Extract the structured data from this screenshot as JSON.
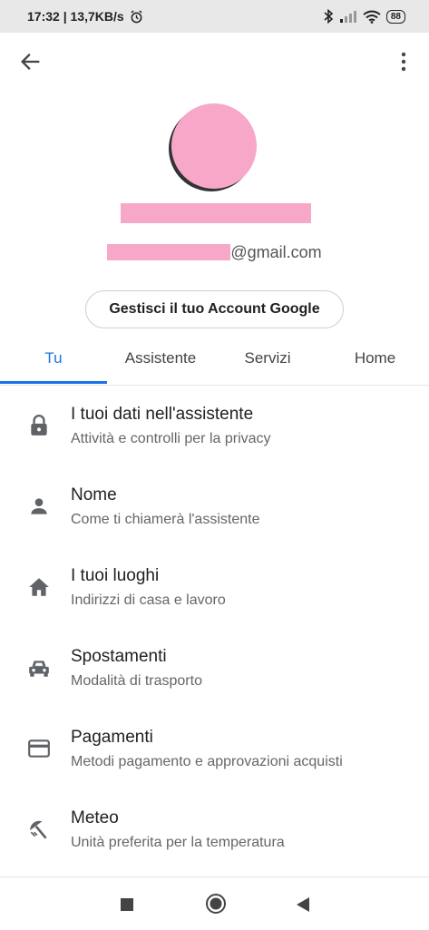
{
  "status_bar": {
    "time_speed": "17:32 | 13,7KB/s",
    "battery": "88"
  },
  "account": {
    "email_suffix": "@gmail.com",
    "manage_label": "Gestisci il tuo Account Google"
  },
  "tabs": [
    {
      "label": "Tu"
    },
    {
      "label": "Assistente"
    },
    {
      "label": "Servizi"
    },
    {
      "label": "Home"
    }
  ],
  "items": [
    {
      "title": "I tuoi dati nell'assistente",
      "subtitle": "Attività e controlli per la privacy",
      "icon": "lock-icon"
    },
    {
      "title": "Nome",
      "subtitle": "Come ti chiamerà l'assistente",
      "icon": "person-icon"
    },
    {
      "title": "I tuoi luoghi",
      "subtitle": "Indirizzi di casa e lavoro",
      "icon": "home-icon"
    },
    {
      "title": "Spostamenti",
      "subtitle": "Modalità di trasporto",
      "icon": "car-icon"
    },
    {
      "title": "Pagamenti",
      "subtitle": "Metodi pagamento e approvazioni acquisti",
      "icon": "credit-card-icon"
    },
    {
      "title": "Meteo",
      "subtitle": "Unità preferita per la temperatura",
      "icon": "weather-icon"
    }
  ],
  "colors": {
    "accent": "#1a73e8",
    "redaction": "#f7a8c8"
  }
}
